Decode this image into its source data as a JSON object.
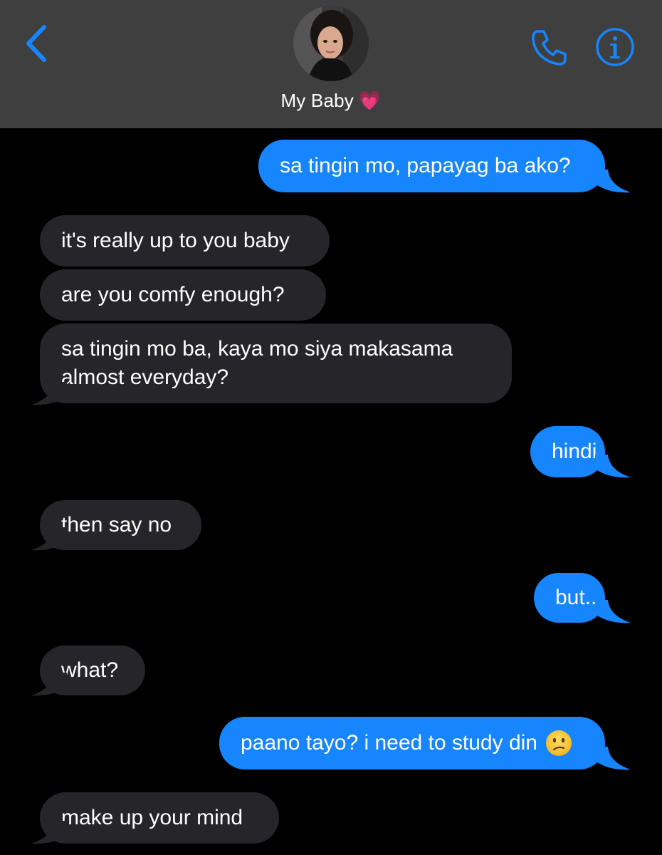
{
  "header": {
    "contact_name": "My Baby",
    "heart_emoji": "💗",
    "back_icon": "chevron-left-icon",
    "phone_icon": "phone-icon",
    "info_icon": "info-icon",
    "accent": "#1685fe"
  },
  "messages": [
    {
      "direction": "outgoing",
      "text": "sa tingin mo, papayag ba ako?"
    },
    {
      "direction": "incoming",
      "text": "it's really up to you baby"
    },
    {
      "direction": "incoming",
      "text": "are you comfy enough?"
    },
    {
      "direction": "incoming",
      "line1": "sa tingin mo ba, kaya mo siya makasama",
      "line2": "almost everyday?"
    },
    {
      "direction": "outgoing",
      "text": "hindi"
    },
    {
      "direction": "incoming",
      "text": "then say no"
    },
    {
      "direction": "outgoing",
      "text": "but.."
    },
    {
      "direction": "incoming",
      "text": "what?"
    },
    {
      "direction": "outgoing",
      "text": "paano tayo? i need to study din",
      "emoji": "😕"
    },
    {
      "direction": "incoming",
      "text": "make up your mind"
    }
  ],
  "colors": {
    "header_bg": "#3f3f3f",
    "outgoing_bubble": "#1685fe",
    "incoming_bubble": "#262529",
    "background": "#000000"
  }
}
